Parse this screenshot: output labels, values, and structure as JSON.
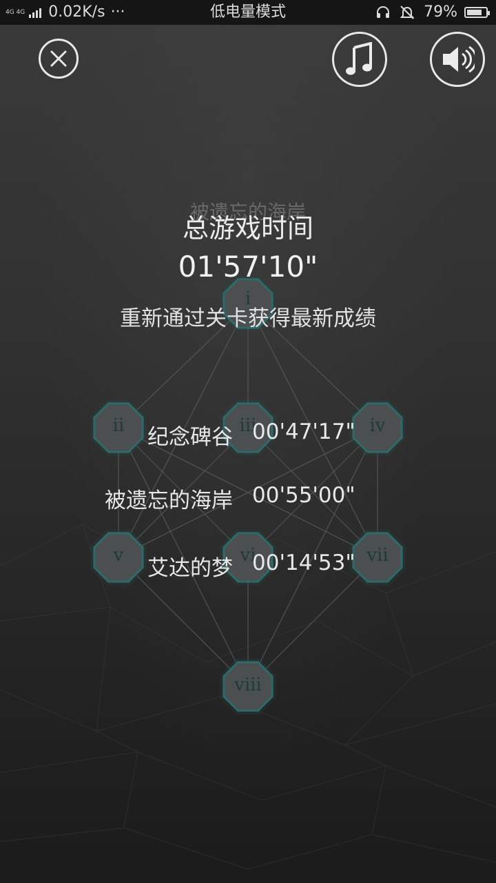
{
  "status_bar": {
    "network_type": "4G 4G",
    "speed": "0.02K/s",
    "more": "···",
    "mode": "低电量模式",
    "battery_percent": "79%",
    "battery_level": 0.79,
    "icons": [
      "signal-icon",
      "headset-icon",
      "mute-bell-icon",
      "battery-icon"
    ]
  },
  "toolbar": {
    "close_icon": "close-icon",
    "music_icon": "music-note-icon",
    "sound_icon": "speaker-icon"
  },
  "map": {
    "faded_title": "被遗忘的海岸",
    "nodes": [
      "i",
      "ii",
      "iii",
      "iv",
      "v",
      "vi",
      "vii",
      "viii"
    ]
  },
  "summary": {
    "title": "总游戏时间",
    "total_time": "01'57'10\"",
    "hint": "重新通过关卡获得最新成绩",
    "records": [
      {
        "name": "纪念碑谷",
        "time": "00'47'17\""
      },
      {
        "name": "被遗忘的海岸",
        "time": "00'55'00\""
      },
      {
        "name": "艾达的梦",
        "time": "00'14'53\""
      }
    ]
  }
}
